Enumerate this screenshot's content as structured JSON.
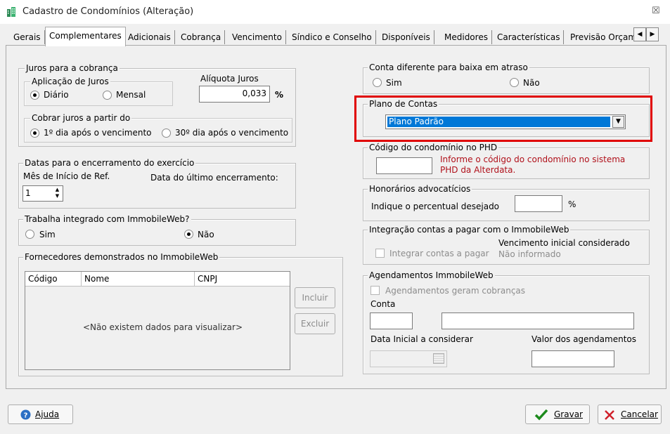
{
  "window": {
    "title": "Cadastro de Condomínios (Alteração)",
    "close": "☒"
  },
  "tabs": [
    "Gerais",
    "Complementares",
    "Adicionais",
    "Cobrança",
    "Vencimento",
    "Síndico e Conselho",
    "Disponíveis",
    "Medidores",
    "Características",
    "Previsão Orçam"
  ],
  "tab_scroll": {
    "left": "◀",
    "right": "▶"
  },
  "juros": {
    "title": "Juros para a cobrança",
    "aplicacao_title": "Aplicação de Juros",
    "diario": "Diário",
    "mensal": "Mensal",
    "aliquota_label": "Alíquota Juros",
    "aliquota_value": "0,033",
    "percent": "%",
    "cobrar_title": "Cobrar juros a partir do",
    "opt1": "1º dia após o vencimento",
    "opt2": "30º dia após o vencimento"
  },
  "datas": {
    "title": "Datas para o encerramento do exercício",
    "mes_label": "Mês de Início de Ref.",
    "mes_value": "1",
    "ultimo_label": "Data do último encerramento:"
  },
  "immobile": {
    "title": "Trabalha integrado com ImmobileWeb?",
    "sim": "Sim",
    "nao": "Não"
  },
  "fornecedores": {
    "title": "Fornecedores demonstrados no ImmobileWeb",
    "columns": [
      "Código",
      "Nome",
      "CNPJ"
    ],
    "empty": "<Não existem dados para visualizar>",
    "incluir": "Incluir",
    "excluir": "Excluir"
  },
  "conta_diferente": {
    "title": "Conta diferente para baixa em atraso",
    "sim": "Sim",
    "nao": "Não"
  },
  "plano": {
    "title": "Plano de Contas",
    "value": "Plano Padrão"
  },
  "codigo_phd": {
    "title": "Código do condomínio no PHD",
    "hint1": "Informe o código do condomínio no sistema",
    "hint2": "PHD da Alterdata."
  },
  "honorarios": {
    "title": "Honorários advocatícios",
    "label": "Indique o percentual desejado",
    "percent": "%"
  },
  "integracao": {
    "title": "Integração contas a pagar com o ImmobileWeb",
    "checkbox": "Integrar contas a pagar",
    "venc_label": "Vencimento inicial considerado",
    "venc_value": "Não informado"
  },
  "agendamentos": {
    "title": "Agendamentos ImmobileWeb",
    "checkbox": "Agendamentos geram cobranças",
    "conta_label": "Conta",
    "data_label": "Data Inicial a considerar",
    "valor_label": "Valor dos agendamentos"
  },
  "footer": {
    "ajuda": "Ajuda",
    "gravar": "Gravar",
    "cancelar": "Cancelar"
  },
  "colors": {
    "highlight": "#e00000",
    "selection": "#0078d7",
    "hint": "#b0101a"
  }
}
